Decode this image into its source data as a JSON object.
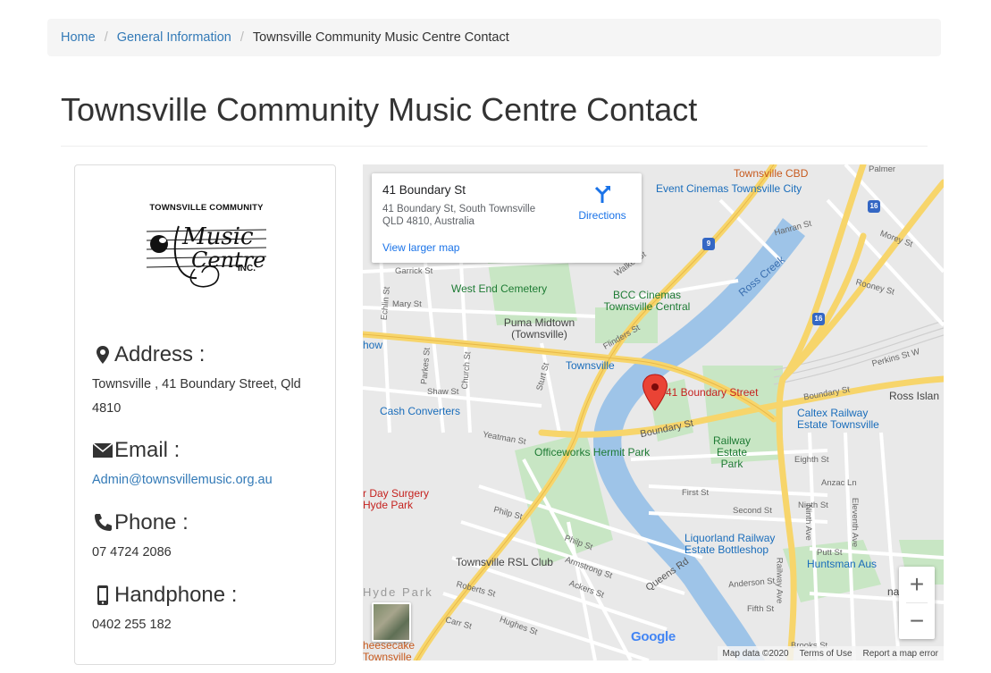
{
  "breadcrumb": {
    "home": "Home",
    "section": "General Information",
    "current": "Townsville Community Music Centre Contact",
    "separator": "/"
  },
  "page": {
    "title": "Townsville Community Music Centre Contact"
  },
  "logo": {
    "top_text": "TOWNSVILLE COMMUNITY",
    "script_text_1": "Music",
    "script_text_2": "Centre",
    "inc_text": "INC."
  },
  "contact": {
    "address": {
      "label": "Address :",
      "value": "Townsville , 41 Boundary Street, Qld 4810",
      "icon": "map-marker-icon"
    },
    "email": {
      "label": "Email :",
      "value": "Admin@townsvillemusic.org.au",
      "icon": "envelope-icon"
    },
    "phone": {
      "label": "Phone :",
      "value": "07 4724 2086",
      "icon": "phone-icon"
    },
    "handphone": {
      "label": "Handphone :",
      "value": "0402 255 182",
      "icon": "mobile-phone-icon"
    }
  },
  "map": {
    "place_name": "41 Boundary St",
    "place_address": "41 Boundary St, South Townsville QLD 4810, Australia",
    "view_larger": "View larger map",
    "directions": "Directions",
    "marker_label": "41 Boundary Street",
    "zoom_in": "+",
    "zoom_out": "−",
    "google": "Google",
    "footer": {
      "map_data": "Map data ©2020",
      "terms": "Terms of Use",
      "report": "Report a map error"
    },
    "labels": {
      "event_cinemas": "Event Cinemas Townsville City",
      "townsville_cbd": "Townsville CBD",
      "west_end_cemetery": "West End Cemetery",
      "bcc_cinemas": "BCC Cinemas Townsville Central",
      "puma": "Puma Midtown (Townsville)",
      "townsville_station": "Townsville",
      "ross_creek": "Ross Creek",
      "cash_converters": "Cash Converters",
      "caltex": "Caltex Railway Estate Townsville",
      "officeworks": "Officeworks Hermit Park",
      "railway_estate_park": "Railway Estate Park",
      "day_surgery": "r Day Surgery Hyde Park",
      "liquorland": "Liquorland Railway Estate Bottleshop",
      "huntsman": "Huntsman Aus",
      "rsl": "Townsville RSL Club",
      "hyde_park": "Hyde Park",
      "cheesecake": "heesecake Townsville",
      "ross_island": "Ross Islan",
      "show": "how",
      "national": "national",
      "palmer": "Palmer",
      "boundary_st": "Boundary St",
      "boundary_st_2": "Boundary St",
      "flinders_st": "Flinders St",
      "walker_st": "Walker St",
      "hanran_st": "Hanran St",
      "morey_st": "Morey St",
      "rooney_st": "Rooney St",
      "perkins_st": "Perkins St W",
      "garrick_st": "Garrick St",
      "mary_st": "Mary St",
      "echlin_st": "Echlin St",
      "parkes_st": "Parkes St",
      "church_st": "Church St",
      "shaw_st": "Shaw St",
      "yeatman_st": "Yeatman St",
      "sturt_st": "Sturt St",
      "eighth_st": "Eighth St",
      "first_st": "First St",
      "second_st": "Second St",
      "anzac_ln": "Anzac Ln",
      "ninth_st": "Ninth St",
      "philp_st": "Philp St",
      "armstrong_st": "Armstrong St",
      "ackers_st": "Ackers St",
      "roberts_st": "Roberts St",
      "carr_st": "Carr St",
      "hughes_st": "Hughes St",
      "queens_rd": "Queens Rd",
      "anderson_st": "Anderson St",
      "fifth_st": "Fifth St",
      "brooks_st": "Brooks St",
      "railway_ave": "Railway Ave",
      "ninth_ave": "Ninth Ave",
      "eleventh_ave": "Eleventh Ave",
      "putt_st": "Putt St",
      "route_9": "9",
      "route_16": "16",
      "route_16b": "16"
    }
  }
}
